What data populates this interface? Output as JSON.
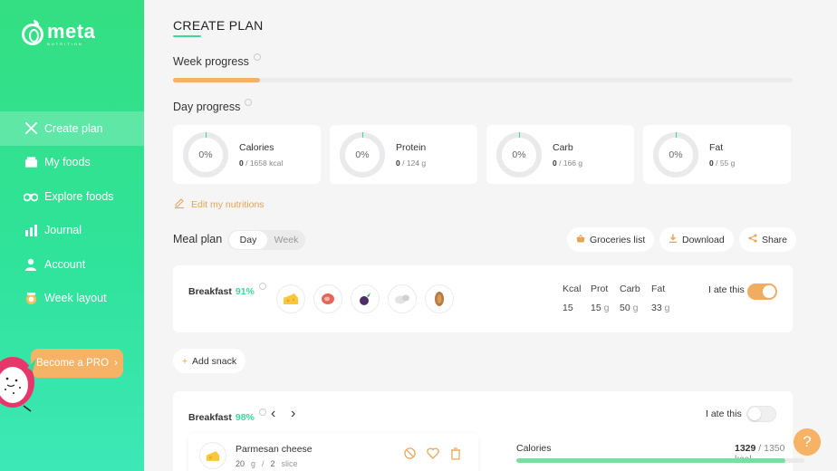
{
  "brand": {
    "word": "meta",
    "tagline": "NUTRITION"
  },
  "sidebar": {
    "items": [
      {
        "label": "Create plan",
        "icon": "fork-knife-icon",
        "active": true
      },
      {
        "label": "My foods",
        "icon": "food-box-icon"
      },
      {
        "label": "Explore foods",
        "icon": "binoculars-icon"
      },
      {
        "label": "Journal",
        "icon": "bar-chart-icon"
      },
      {
        "label": "Account",
        "icon": "user-icon"
      },
      {
        "label": "Week layout",
        "icon": "calendar-icon"
      }
    ],
    "pro_label": "Become a PRO"
  },
  "page": {
    "title": "CREATE PLAN",
    "week_progress": {
      "label": "Week progress",
      "value": 0.14
    },
    "day_progress_label": "Day progress",
    "nutrients": [
      {
        "name": "Calories",
        "pct": "0%",
        "current": "0",
        "target": "/ 1658 kcal"
      },
      {
        "name": "Protein",
        "pct": "0%",
        "current": "0",
        "target": "/ 124 g"
      },
      {
        "name": "Carb",
        "pct": "0%",
        "current": "0",
        "target": "/ 166 g"
      },
      {
        "name": "Fat",
        "pct": "0%",
        "current": "0",
        "target": "/ 55 g"
      }
    ],
    "edit_label": "Edit my nutritions",
    "meal_plan": {
      "label": "Meal plan",
      "toggle": [
        "Day",
        "Week"
      ],
      "actions": {
        "groceries": "Groceries list",
        "download": "Download",
        "share": "Share"
      }
    },
    "meal1": {
      "name": "Breakfast",
      "pct": "91%",
      "foods": [
        "cheese-icon",
        "meat-icon",
        "eggplant-icon",
        "egg-icon",
        "almond-icon"
      ],
      "macros": {
        "headers": [
          "Kcal",
          "Prot",
          "Carb",
          "Fat"
        ],
        "values": [
          "15",
          "15",
          "50",
          "33"
        ],
        "units": [
          "",
          "g",
          "g",
          "g"
        ]
      },
      "ate_label": "I ate this",
      "ate": true
    },
    "add_snack": "Add snack",
    "meal2": {
      "name": "Breakfast",
      "pct": "98%",
      "ate_label": "I ate this",
      "ate": false,
      "food": {
        "name": "Parmesan cheese",
        "amount": "20",
        "unit": "g",
        "sep": "/",
        "count": "2",
        "count_unit": "slice"
      },
      "calories": {
        "label": "Calories",
        "current": "1329",
        "target": "/ 1350 kcal",
        "fraction": 0.934
      }
    }
  },
  "help": "?"
}
